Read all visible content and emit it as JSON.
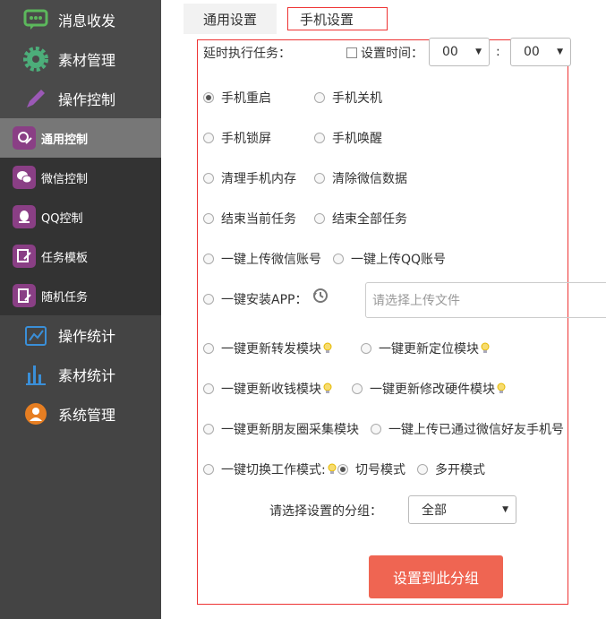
{
  "sidebar": {
    "items": [
      {
        "label": "消息收发",
        "icon": "chat-icon"
      },
      {
        "label": "素材管理",
        "icon": "gear-icon"
      },
      {
        "label": "操作控制",
        "icon": "pencil-icon"
      },
      {
        "label": "通用控制",
        "icon": "settings-edit-icon"
      },
      {
        "label": "微信控制",
        "icon": "wechat-icon"
      },
      {
        "label": "QQ控制",
        "icon": "qq-icon"
      },
      {
        "label": "任务模板",
        "icon": "template-icon"
      },
      {
        "label": "随机任务",
        "icon": "random-task-icon"
      },
      {
        "label": "操作统计",
        "icon": "line-chart-icon"
      },
      {
        "label": "素材统计",
        "icon": "bar-chart-icon"
      },
      {
        "label": "系统管理",
        "icon": "user-icon"
      }
    ]
  },
  "tabs": [
    {
      "label": "通用设置"
    },
    {
      "label": "手机设置"
    }
  ],
  "delay": {
    "label": "延时执行任务：",
    "checkbox_label": "设置时间：",
    "hour": "00",
    "minute": "00",
    "sep": ":"
  },
  "options": {
    "restart": "手机重启",
    "shutdown": "手机关机",
    "lock": "手机锁屏",
    "wake": "手机唤醒",
    "clear_mem": "清理手机内存",
    "clear_wechat": "清除微信数据",
    "end_current": "结束当前任务",
    "end_all": "结束全部任务",
    "upload_wechat": "一键上传微信账号",
    "upload_qq": "一键上传QQ账号",
    "install_app": "一键安装APP：",
    "upload_placeholder": "请选择上传文件",
    "update_forward": "一键更新转发模块",
    "update_locate": "一键更新定位模块",
    "update_pay": "一键更新收钱模块",
    "update_hw": "一键更新修改硬件模块",
    "update_moments": "一键更新朋友圈采集模块",
    "upload_friends": "一键上传已通过微信好友手机号",
    "switch_mode": "一键切换工作模式:",
    "mode_switch": "切号模式",
    "mode_multi": "多开模式"
  },
  "group": {
    "label": "请选择设置的分组：",
    "value": "全部"
  },
  "submit_label": "设置到此分组"
}
